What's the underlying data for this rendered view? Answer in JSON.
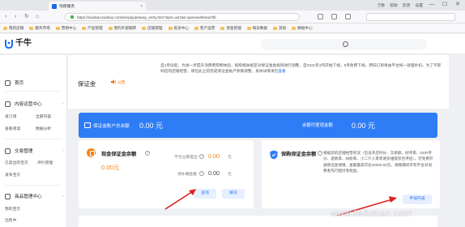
{
  "browser": {
    "tab_title": "淘保服务",
    "tab_close": "×",
    "window_links": [
      "万象",
      "帮助",
      "反馈",
      "设置"
    ],
    "window_buttons": [
      "—",
      "☐",
      "✕"
    ],
    "url": "https://xiaobao.taobao.com/prepay/prepay_entry.htm?spm=a21lwl.openworkbeachfb",
    "bookmarks": [
      "我的店铺",
      "服务市场",
      "营销中心",
      "产品管理",
      "我的外部跳转",
      "店铺管理",
      "投诉中心",
      "客户运营",
      "资金管理",
      "每日数据",
      "其他",
      "数据中心"
    ]
  },
  "app": {
    "logo_text": "千牛",
    "accent": "#2e7cf6",
    "orange": "#f5820f"
  },
  "sidebar": {
    "home": "首页",
    "groups": [
      {
        "label": "内容运营中心",
        "subs": [
          "发订阅",
          "全部内容",
          "查看阅读",
          "数据分析"
        ]
      },
      {
        "label": "交易管理",
        "subs": [
          "已卖出的宝贝",
          "评价管理",
          "发布宝贝"
        ]
      },
      {
        "label": "商品管理中心",
        "subs": [
          "我的宝贝",
          "出售中"
        ]
      }
    ]
  },
  "header": {
    "page_title": "保证金",
    "audio_label": "公告",
    "notice": "自1月份起，为进一步提升消费者购物体验，按照相关规定对保证金类规则进行调整，自2021年3月开始下线，9月免费下线，原旧订单将由平台统一处理补扣，为了不影响您的店铺经营，请在此之前完成保证金账户余额调整，具体详情请见",
    "notice_link": "查看"
  },
  "balance": {
    "label": "保证金账户总余额",
    "value": "0.00 元",
    "right_label": "余额可提现金额",
    "right_value": "0.00 元"
  },
  "cash_card": {
    "title": "现金保证金余额",
    "amount": "0.00元",
    "withdrawable_label": "不可立即提出",
    "withdrawable_value": "0.00",
    "withdrawable_unit": "元",
    "frozen_label": "待补缴金额",
    "frozen_value": "0.00",
    "frozen_unit": "元",
    "btn_view": "查询",
    "btn_unfreeze": "解冻"
  },
  "insurance_card": {
    "title": "保购保证金余额",
    "description": "根据您的店铺经营状况（包含开店时长、交易额、好评率、DSR评分、退款率、纠纷率、小二介入率等诸多维度综合评估），可免费开通保证金保障，金额最高可达10000.00元，保障期间享有平台对消费者先行赔付等权益，",
    "btn_open": "申请开通"
  },
  "watermark": "www.liefutuan.com"
}
